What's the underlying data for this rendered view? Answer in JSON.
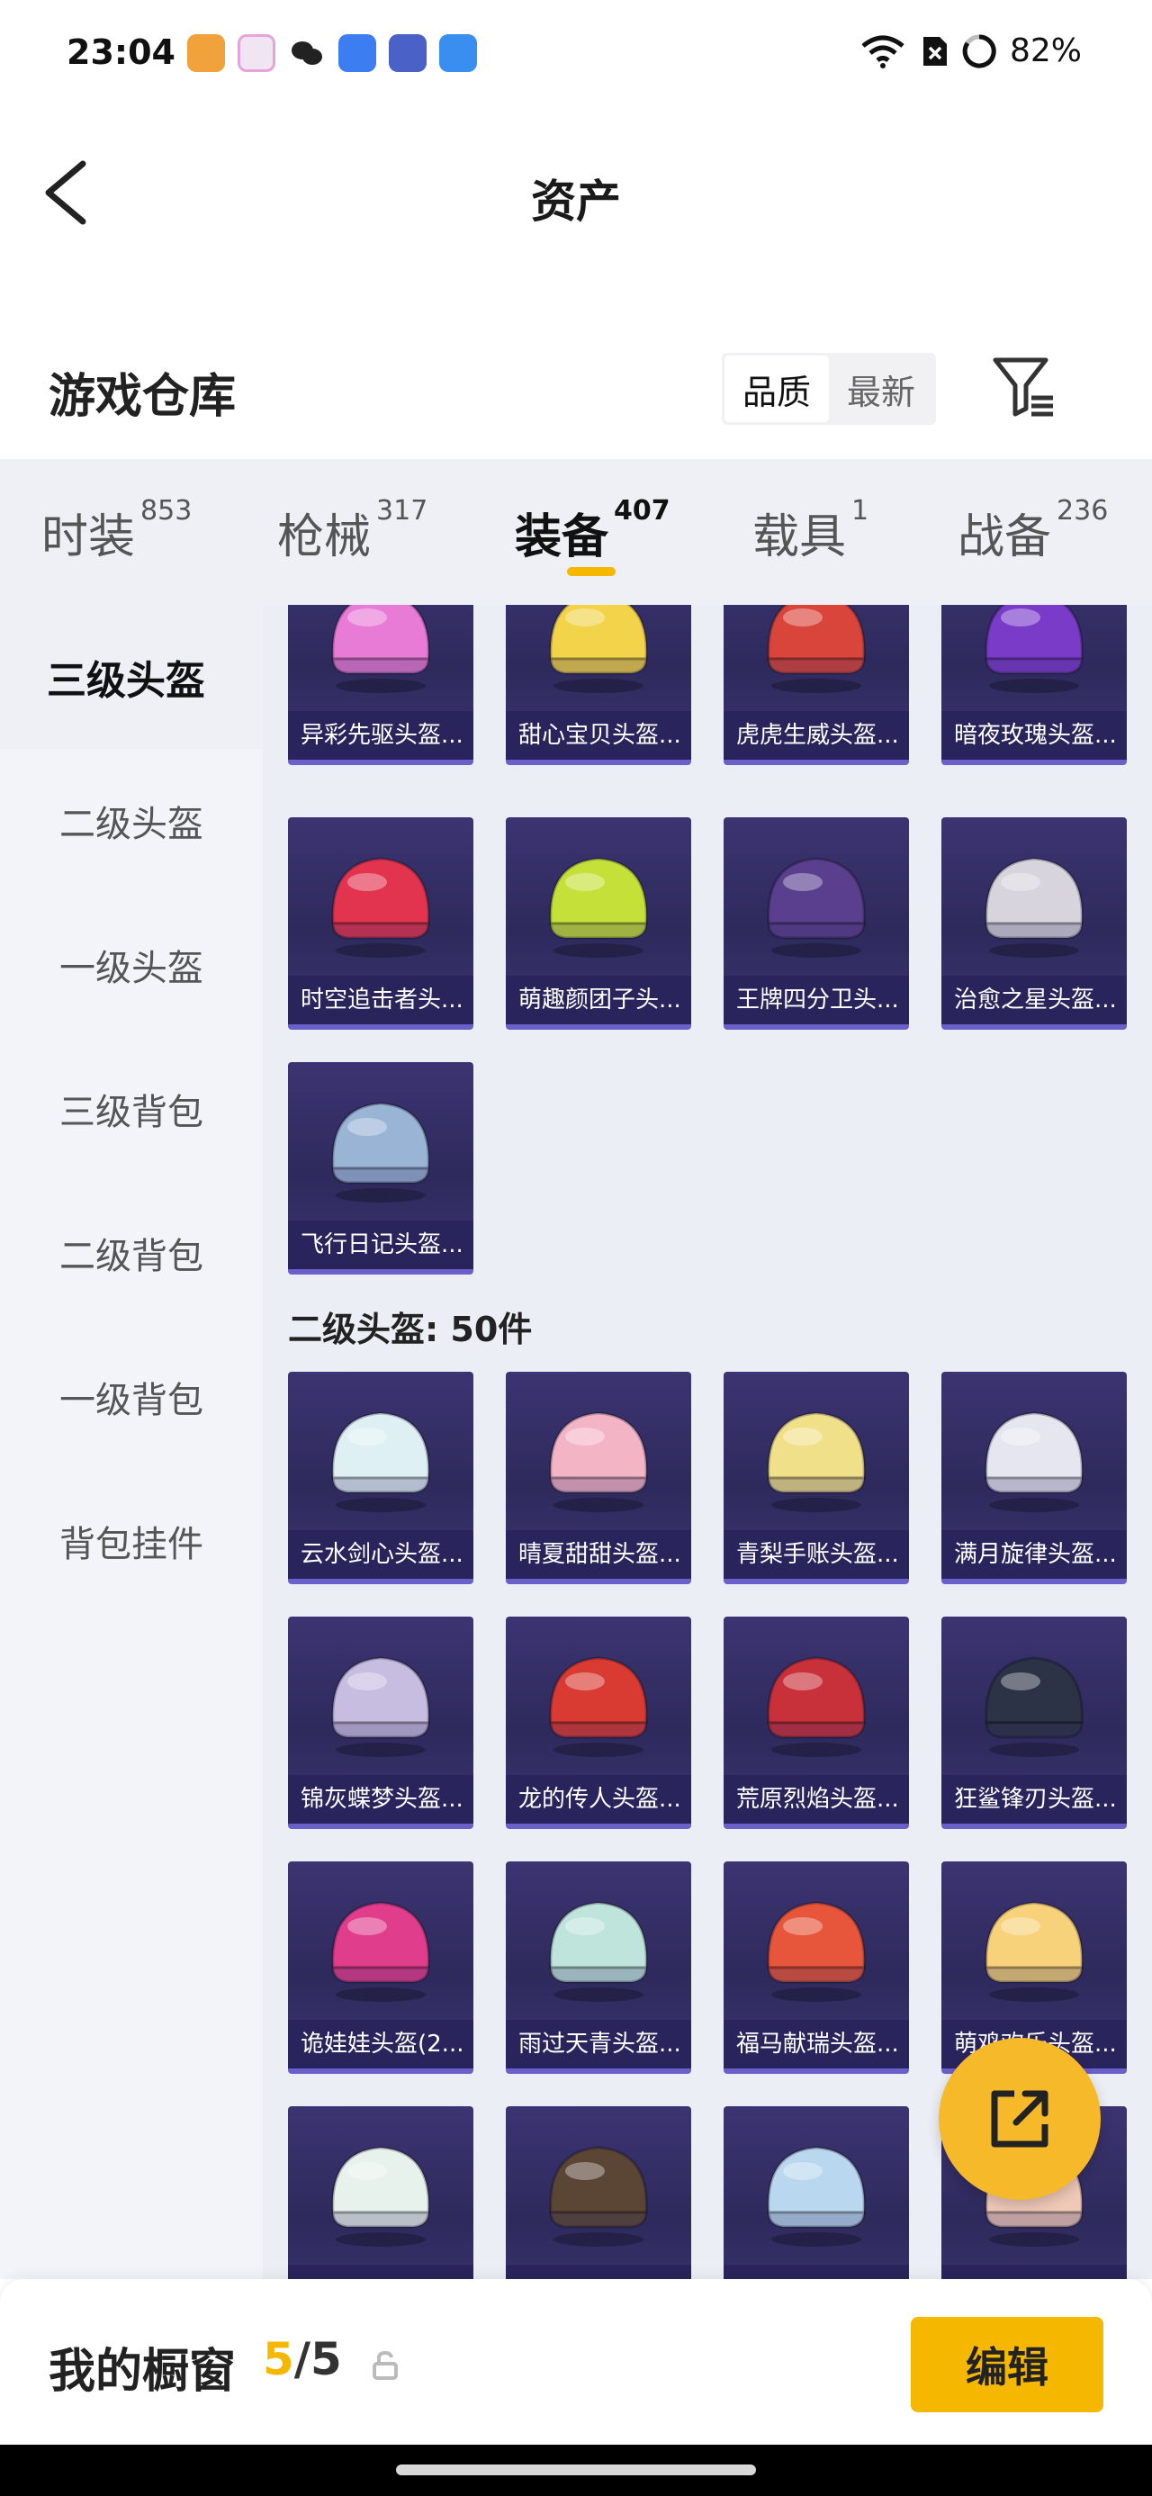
{
  "status_bar": {
    "time": "23:04",
    "battery": "82%"
  },
  "header": {
    "title": "资产"
  },
  "warehouse": {
    "title": "游戏仓库",
    "sort_options": [
      "品质",
      "最新"
    ],
    "active_sort": "品质"
  },
  "categories": [
    {
      "label": "时装",
      "count": "853",
      "active": false
    },
    {
      "label": "枪械",
      "count": "317",
      "active": false
    },
    {
      "label": "装备",
      "count": "407",
      "active": true
    },
    {
      "label": "载具",
      "count": "1",
      "active": false
    },
    {
      "label": "战备",
      "count": "236",
      "active": false
    }
  ],
  "sidebar": {
    "items": [
      {
        "label": "三级头盔",
        "active": true
      },
      {
        "label": "二级头盔",
        "active": false
      },
      {
        "label": "一级头盔",
        "active": false
      },
      {
        "label": "三级背包",
        "active": false
      },
      {
        "label": "二级背包",
        "active": false
      },
      {
        "label": "一级背包",
        "active": false
      },
      {
        "label": "背包挂件",
        "active": false
      }
    ]
  },
  "level3": {
    "items": [
      {
        "name": "异彩先驱头盔...",
        "color": "#e87bd6"
      },
      {
        "name": "甜心宝贝头盔...",
        "color": "#f2d34a"
      },
      {
        "name": "虎虎生威头盔...",
        "color": "#d9453a"
      },
      {
        "name": "暗夜玫瑰头盔...",
        "color": "#7a3bc9"
      },
      {
        "name": "时空追击者头...",
        "color": "#e2344f"
      },
      {
        "name": "萌趣颜团子头...",
        "color": "#c6e03a"
      },
      {
        "name": "王牌四分卫头...",
        "color": "#5a3f8f"
      },
      {
        "name": "治愈之星头盔...",
        "color": "#d7d4de"
      },
      {
        "name": "飞行日记头盔...",
        "color": "#9ab4d6"
      }
    ]
  },
  "level2": {
    "label": "二级头盔: 50件",
    "items": [
      {
        "name": "云水剑心头盔...",
        "color": "#dff0f4"
      },
      {
        "name": "晴夏甜甜头盔...",
        "color": "#f3b4c6"
      },
      {
        "name": "青梨手账头盔...",
        "color": "#f0e08a"
      },
      {
        "name": "满月旋律头盔...",
        "color": "#e6e6f0"
      },
      {
        "name": "锦灰蝶梦头盔...",
        "color": "#c7bde0"
      },
      {
        "name": "龙的传人头盔...",
        "color": "#d93a32"
      },
      {
        "name": "荒原烈焰头盔...",
        "color": "#c8303a"
      },
      {
        "name": "狂鲨锋刃头盔...",
        "color": "#2d3346"
      },
      {
        "name": "诡娃娃头盔(2...",
        "color": "#e03d8c"
      },
      {
        "name": "雨过天青头盔...",
        "color": "#bfe4dc"
      },
      {
        "name": "福马献瑞头盔...",
        "color": "#e7553a"
      },
      {
        "name": "萌鸡欢乐头盔...",
        "color": "#f7d27a"
      },
      {
        "name": "",
        "color": "#e8f2ec"
      },
      {
        "name": "",
        "color": "#5b4636"
      },
      {
        "name": "",
        "color": "#b9d7ee"
      },
      {
        "name": "",
        "color": "#f0c8b8"
      }
    ]
  },
  "showcase": {
    "title": "我的橱窗",
    "current": "5",
    "total": "/5",
    "edit_label": "编辑"
  },
  "colors": {
    "accent": "#f5b700",
    "card_bg": "#2e2a5c"
  },
  "icons": [
    "back-arrow-icon",
    "filter-icon",
    "share-icon",
    "lock-icon",
    "wifi-icon",
    "battery-icon"
  ]
}
